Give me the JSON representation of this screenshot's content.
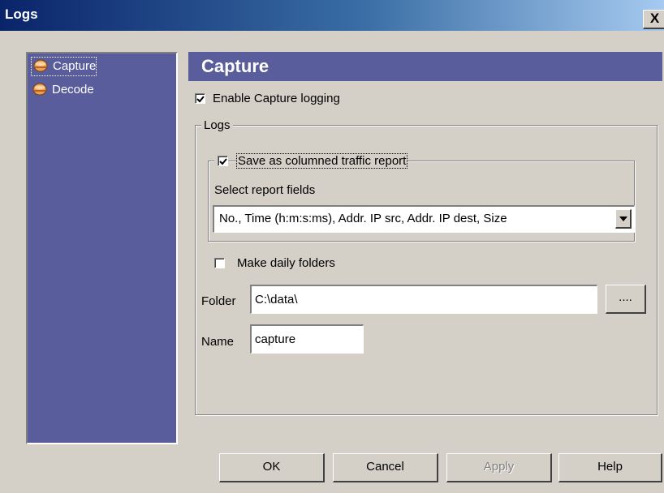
{
  "window": {
    "title": "Logs",
    "close_glyph": "X"
  },
  "sidebar": {
    "items": [
      {
        "label": "Capture",
        "icon": "capture-icon",
        "selected": true
      },
      {
        "label": "Decode",
        "icon": "decode-icon",
        "selected": false
      }
    ]
  },
  "panel": {
    "header": "Capture",
    "enable_logging": {
      "label": "Enable Capture logging",
      "checked": true
    },
    "logs_group": {
      "label": "Logs"
    },
    "columned_report": {
      "label": "Save as columned traffic report",
      "checked": true
    },
    "report_fields": {
      "label": "Select report fields",
      "selected": "No., Time (h:m:s:ms), Addr. IP src, Addr. IP dest, Size"
    },
    "daily_folders": {
      "label": "Make daily folders",
      "checked": false
    },
    "folder": {
      "label": "Folder",
      "value": "C:\\data\\",
      "browse_label": "...."
    },
    "name": {
      "label": "Name",
      "value": "capture"
    }
  },
  "buttons": {
    "ok": "OK",
    "cancel": "Cancel",
    "apply": "Apply",
    "help": "Help"
  },
  "colors": {
    "titlebar_start": "#0a246a",
    "titlebar_end": "#a6caf0",
    "sidebar_bg": "#5a5d9c",
    "dialog_bg": "#d4d0c8"
  }
}
